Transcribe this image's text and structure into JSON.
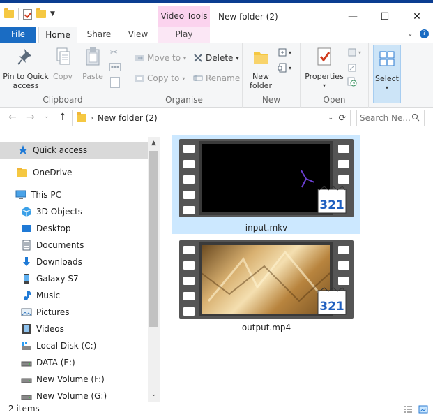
{
  "window": {
    "title": "New folder (2)",
    "context_tab_group": "Video Tools",
    "minimize": "—",
    "maximize": "☐",
    "close": "✕"
  },
  "tabs": {
    "file": "File",
    "home": "Home",
    "share": "Share",
    "view": "View",
    "play": "Play"
  },
  "ribbon": {
    "clipboard": {
      "label": "Clipboard",
      "pin_line1": "Pin to Quick",
      "pin_line2": "access",
      "copy": "Copy",
      "paste": "Paste"
    },
    "organise": {
      "label": "Organise",
      "move_to": "Move to",
      "copy_to": "Copy to",
      "delete": "Delete",
      "rename": "Rename"
    },
    "new": {
      "label": "New",
      "new_folder_line1": "New",
      "new_folder_line2": "folder"
    },
    "open": {
      "label": "Open",
      "properties": "Properties"
    },
    "select": {
      "label": "Select"
    }
  },
  "address": {
    "path": "New folder (2)",
    "search_placeholder": "Search Ne..."
  },
  "nav": {
    "items": [
      {
        "label": "Quick access"
      },
      {
        "label": "OneDrive"
      },
      {
        "label": "This PC"
      },
      {
        "label": "3D Objects"
      },
      {
        "label": "Desktop"
      },
      {
        "label": "Documents"
      },
      {
        "label": "Downloads"
      },
      {
        "label": "Galaxy S7"
      },
      {
        "label": "Music"
      },
      {
        "label": "Pictures"
      },
      {
        "label": "Videos"
      },
      {
        "label": "Local Disk (C:)"
      },
      {
        "label": "DATA (E:)"
      },
      {
        "label": "New Volume (F:)"
      },
      {
        "label": "New Volume (G:)"
      }
    ]
  },
  "files": [
    {
      "name": "input.mkv",
      "badge": "321"
    },
    {
      "name": "output.mp4",
      "badge": "321"
    }
  ],
  "status": {
    "count": "2 items"
  },
  "colors": {
    "file_tab": "#1a6cc3",
    "context_tab": "#fbd3ee",
    "selection": "#cce8ff",
    "titlebar_top": "#0b3d91"
  }
}
